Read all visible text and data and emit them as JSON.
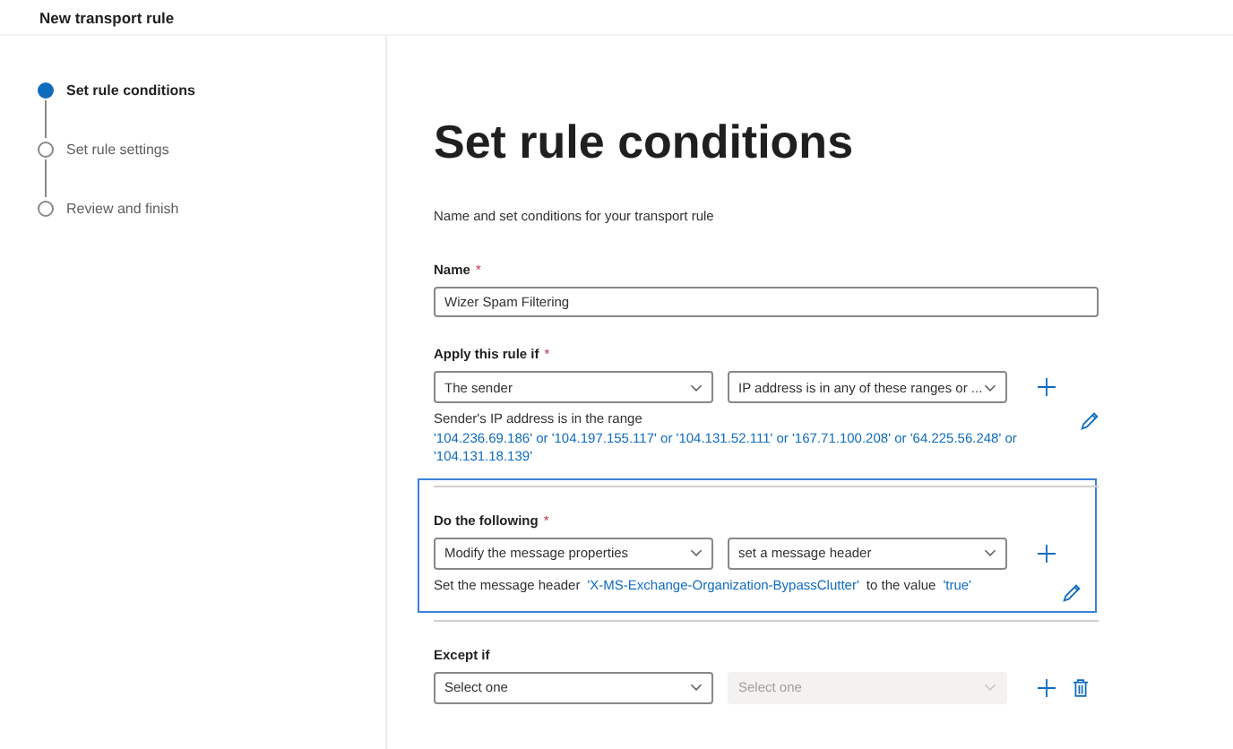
{
  "window": {
    "title": "New transport rule"
  },
  "steps": [
    {
      "label": "Set rule conditions",
      "selected": true
    },
    {
      "label": "Set rule settings",
      "selected": false
    },
    {
      "label": "Review and finish",
      "selected": false
    }
  ],
  "heading": "Set rule conditions",
  "description": "Name and set conditions for your transport rule",
  "name_field": {
    "label": "Name",
    "required_mark": "*",
    "value": "Wizer Spam Filtering"
  },
  "sections": [
    {
      "label": "Apply this rule if",
      "required_mark": "*",
      "focused": false,
      "dropdowns": [
        {
          "value": "The sender",
          "disabled": false
        },
        {
          "value": "IP address is in any of these ranges or ...",
          "disabled": false
        }
      ],
      "row_actions": [
        {
          "kind": "add"
        }
      ],
      "summary_actions": [
        {
          "kind": "edit"
        }
      ],
      "summary": [
        {
          "kind": "text",
          "text": "Sender's IP address is in the range"
        },
        {
          "kind": "block_link",
          "text": "'104.236.69.186' or '104.197.155.117' or '104.131.52.111' or '167.71.100.208' or '64.225.56.248' or '104.131.18.139'"
        }
      ]
    },
    {
      "label": "Do the following",
      "required_mark": "*",
      "focused": true,
      "dropdowns": [
        {
          "value": "Modify the message properties",
          "disabled": false
        },
        {
          "value": "set a message header",
          "disabled": false
        }
      ],
      "row_actions": [
        {
          "kind": "add"
        }
      ],
      "summary_actions": [
        {
          "kind": "edit"
        }
      ],
      "summary": [
        {
          "kind": "text",
          "text": "Set the message header"
        },
        {
          "kind": "link",
          "text": "'X-MS-Exchange-Organization-BypassClutter'"
        },
        {
          "kind": "text",
          "text": "to the value"
        },
        {
          "kind": "link",
          "text": "'true'"
        }
      ]
    },
    {
      "label": "Except if",
      "focused": false,
      "dropdowns": [
        {
          "value": "Select one",
          "disabled": false
        },
        {
          "value": "Select one",
          "disabled": true
        }
      ],
      "row_actions": [
        {
          "kind": "add"
        },
        {
          "kind": "delete"
        }
      ]
    }
  ]
}
